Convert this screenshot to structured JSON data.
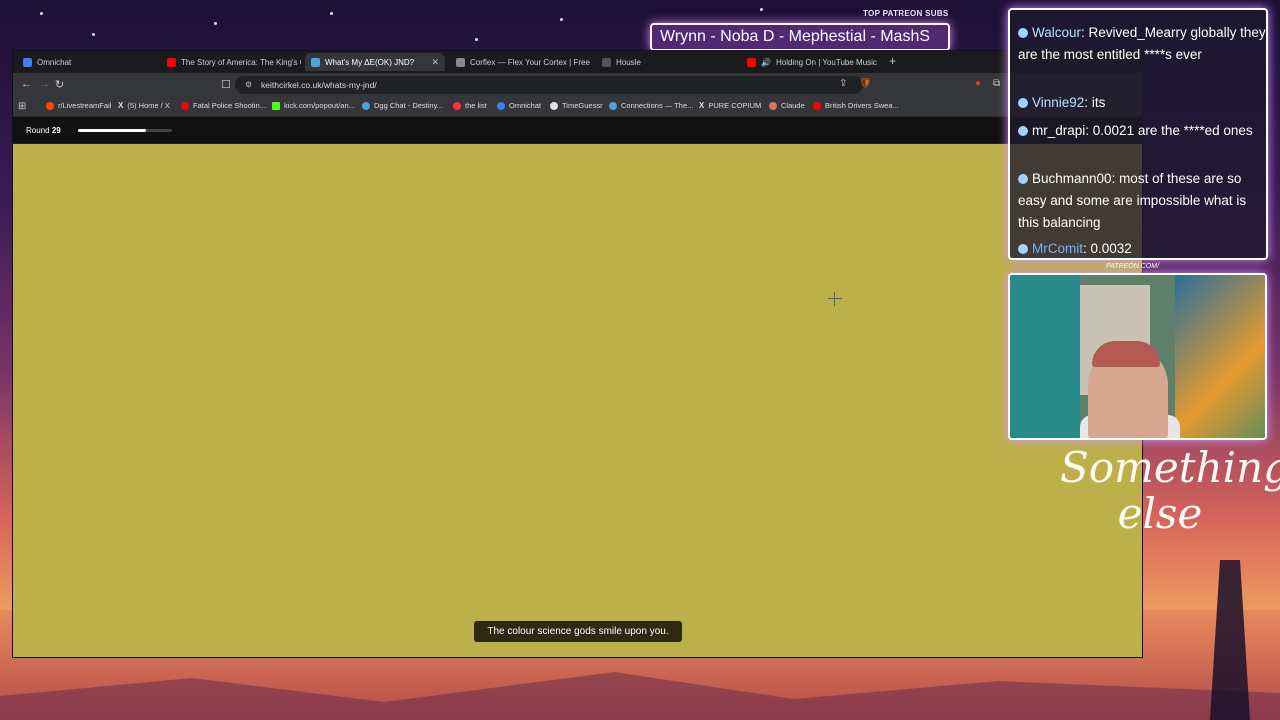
{
  "browser": {
    "tabs": [
      {
        "label": "Omnichat",
        "color": "#3b82f6",
        "active": false
      },
      {
        "label": "The Story of America: The King's Call",
        "color": "#ff0000",
        "active": false
      },
      {
        "label": "What's My ΔE(OK) JND?",
        "color": "#4aa3df",
        "active": true
      },
      {
        "label": "Corflex — Flex Your Cortex | Free Bra",
        "color": "#888888",
        "active": false
      },
      {
        "label": "Housle",
        "color": "#555555",
        "active": false
      },
      {
        "label": "Holding On | YouTube Music",
        "color": "#ff0000",
        "active": false
      }
    ],
    "url": "keithcirkel.co.uk/whats-my-jnd/",
    "bookmarks": [
      {
        "label": "r/LivestreamFail",
        "color": "#ff4500"
      },
      {
        "label": "(5) Home / X",
        "color": "#ffffff"
      },
      {
        "label": "Fatal Police Shootin...",
        "color": "#ff0000"
      },
      {
        "label": "kick.com/popout/an...",
        "color": "#53fc18"
      },
      {
        "label": "Dgg Chat - Destiny...",
        "color": "#4aa3df"
      },
      {
        "label": "the list",
        "color": "#ff3040"
      },
      {
        "label": "Omnichat",
        "color": "#3b82f6"
      },
      {
        "label": "TimeGuessr",
        "color": "#e0e0e0"
      },
      {
        "label": "Connections — The...",
        "color": "#4aa3df"
      },
      {
        "label": "PURE COPIUM",
        "color": "#ffffff"
      },
      {
        "label": "Claude",
        "color": "#d97757"
      },
      {
        "label": "British Drivers Swea...",
        "color": "#ff0000"
      }
    ]
  },
  "game": {
    "round_label": "Round",
    "round_number": "29",
    "progress": 0.72,
    "canvas_color": "#bdb04a",
    "toast": "The colour science gods smile upon you."
  },
  "overlay": {
    "subs_title": "TOP PATREON SUBS",
    "subs_names": "Wrynn -  Noba D - Mephestial - MashS",
    "patreon_url": "PATREON.COM/",
    "logo_text": "Something else",
    "chat": [
      {
        "user": "Walcour",
        "user_color": "#b5e3ff",
        "text": ": Revived_Mearry globally they are the most entitled ****s ever"
      },
      {
        "user": "Vinnie92",
        "user_color": "#b5e3ff",
        "text": ": its"
      },
      {
        "user": "mr_drapi",
        "user_color": "#ffffff",
        "text": ": 0.0021 are the ****ed ones"
      },
      {
        "user": "Buchmann00",
        "user_color": "#ffffff",
        "text": ": most of these are so easy and some are impossible what is this balancing"
      },
      {
        "user": "MrComit",
        "user_color": "#6fb6ff",
        "text": ": 0.0032"
      }
    ]
  }
}
